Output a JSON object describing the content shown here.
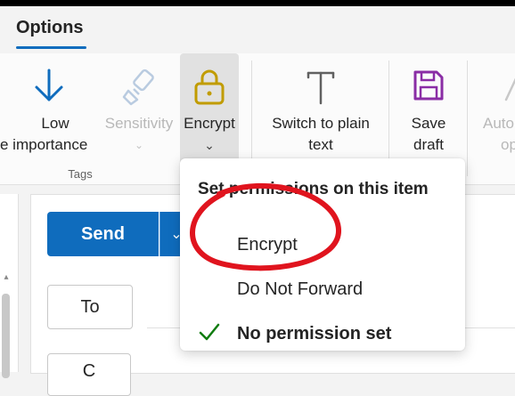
{
  "tabs": {
    "active_label": "Options"
  },
  "ribbon": {
    "low_importance": {
      "line1": "Low",
      "line2": "e importance"
    },
    "sensitivity": {
      "label": "Sensitivity"
    },
    "encrypt": {
      "label": "Encrypt"
    },
    "switch_plain": {
      "line1": "Switch to plain",
      "line2": "text"
    },
    "save_draft": {
      "line1": "Save",
      "line2": "draft"
    },
    "auto": {
      "line1": "Auto",
      "line2": "op"
    },
    "group_tags": "Tags"
  },
  "compose": {
    "send_label": "Send",
    "to_label": "To",
    "cc_label": "C"
  },
  "menu": {
    "title": "Set permissions on this item",
    "items": [
      {
        "label": "Encrypt"
      },
      {
        "label": "Do Not Forward"
      },
      {
        "label": "No permission set",
        "selected": true
      }
    ]
  },
  "colors": {
    "accent": "#0f6cbd",
    "encrypt_icon": "#c19c00",
    "save_icon": "#8a2da5",
    "annotation": "#e0141e",
    "check": "#107c10"
  }
}
